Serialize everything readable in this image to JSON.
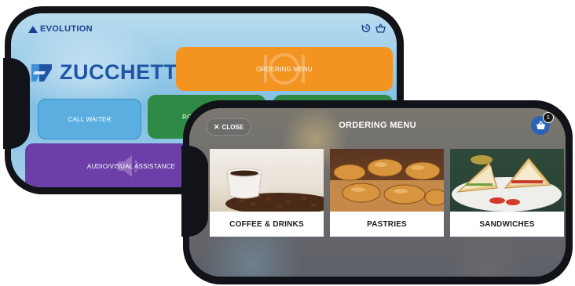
{
  "back_app": {
    "brand": "EVOLUTION",
    "logo_text": "ZUCCHETTI",
    "tiles": {
      "ordering_menu": "ORDERING MENU",
      "call_waiter": "CALL WAITER",
      "room": "ROO",
      "audio_visual": "AUDIO/VISUAL ASSISTANCE"
    },
    "icons": {
      "history": "history-icon",
      "basket": "basket-icon"
    },
    "colors": {
      "orange": "#f39320",
      "green": "#2f8a45",
      "purple": "#6b3fa7",
      "blue": "#5aaee0",
      "brand": "#1f55a6"
    }
  },
  "front_app": {
    "close_label": "CLOSE",
    "title": "ORDERING MENU",
    "cart_count": "1",
    "categories": [
      {
        "label": "COFFEE & DRINKS",
        "image": "coffee-cup-beans"
      },
      {
        "label": "PASTRIES",
        "image": "croissants-pastries"
      },
      {
        "label": "SANDWICHES",
        "image": "club-sandwiches"
      }
    ],
    "colors": {
      "cart": "#2a63b8"
    }
  }
}
